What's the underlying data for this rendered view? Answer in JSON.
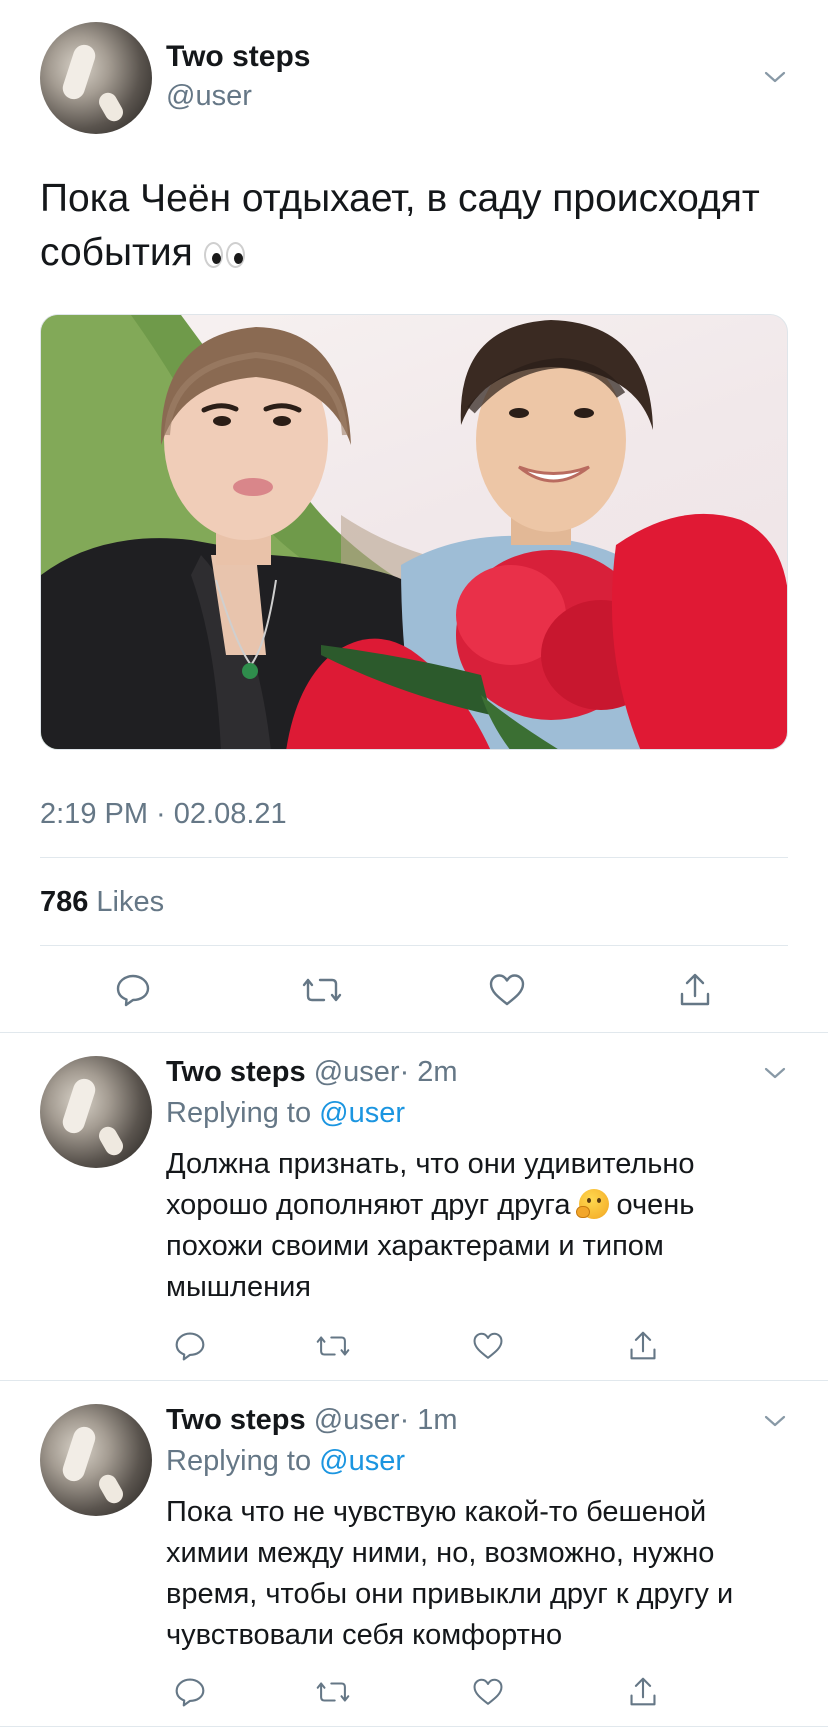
{
  "main_tweet": {
    "author_name": "Two steps",
    "author_handle": "@user",
    "text": "Пока Чеён отдыхает, в саду происходят события",
    "timestamp": "2:19 PM · 02.08.21",
    "likes_count": "786",
    "likes_label": "Likes"
  },
  "replies": [
    {
      "author_name": "Two steps",
      "author_handle": "@user",
      "time": "· 2m",
      "replying_label": "Replying to",
      "replying_to": "@user",
      "text_part1": "Должна признать, что они удивительно хорошо дополняют друг друга",
      "text_part2": "очень похожи своими характерами и типом мышления"
    },
    {
      "author_name": "Two steps",
      "author_handle": "@user",
      "time": "· 1m",
      "replying_label": "Replying to",
      "replying_to": "@user",
      "text": "Пока что не чувствую какой-то бешеной химии между ними, но, возможно, нужно время, чтобы они привыкли друг к другу и чувствовали себя комфортно"
    }
  ],
  "icons": {
    "more": "chevron-down-icon",
    "reply": "reply-icon",
    "retweet": "retweet-icon",
    "like": "heart-icon",
    "share": "share-icon",
    "emoji_main": "eyes-emoji-icon",
    "emoji_reply": "thinking-face-emoji-icon"
  },
  "colors": {
    "text_primary": "#14171a",
    "text_secondary": "#657786",
    "link": "#1b95e0",
    "divider": "#e1e8ed"
  }
}
